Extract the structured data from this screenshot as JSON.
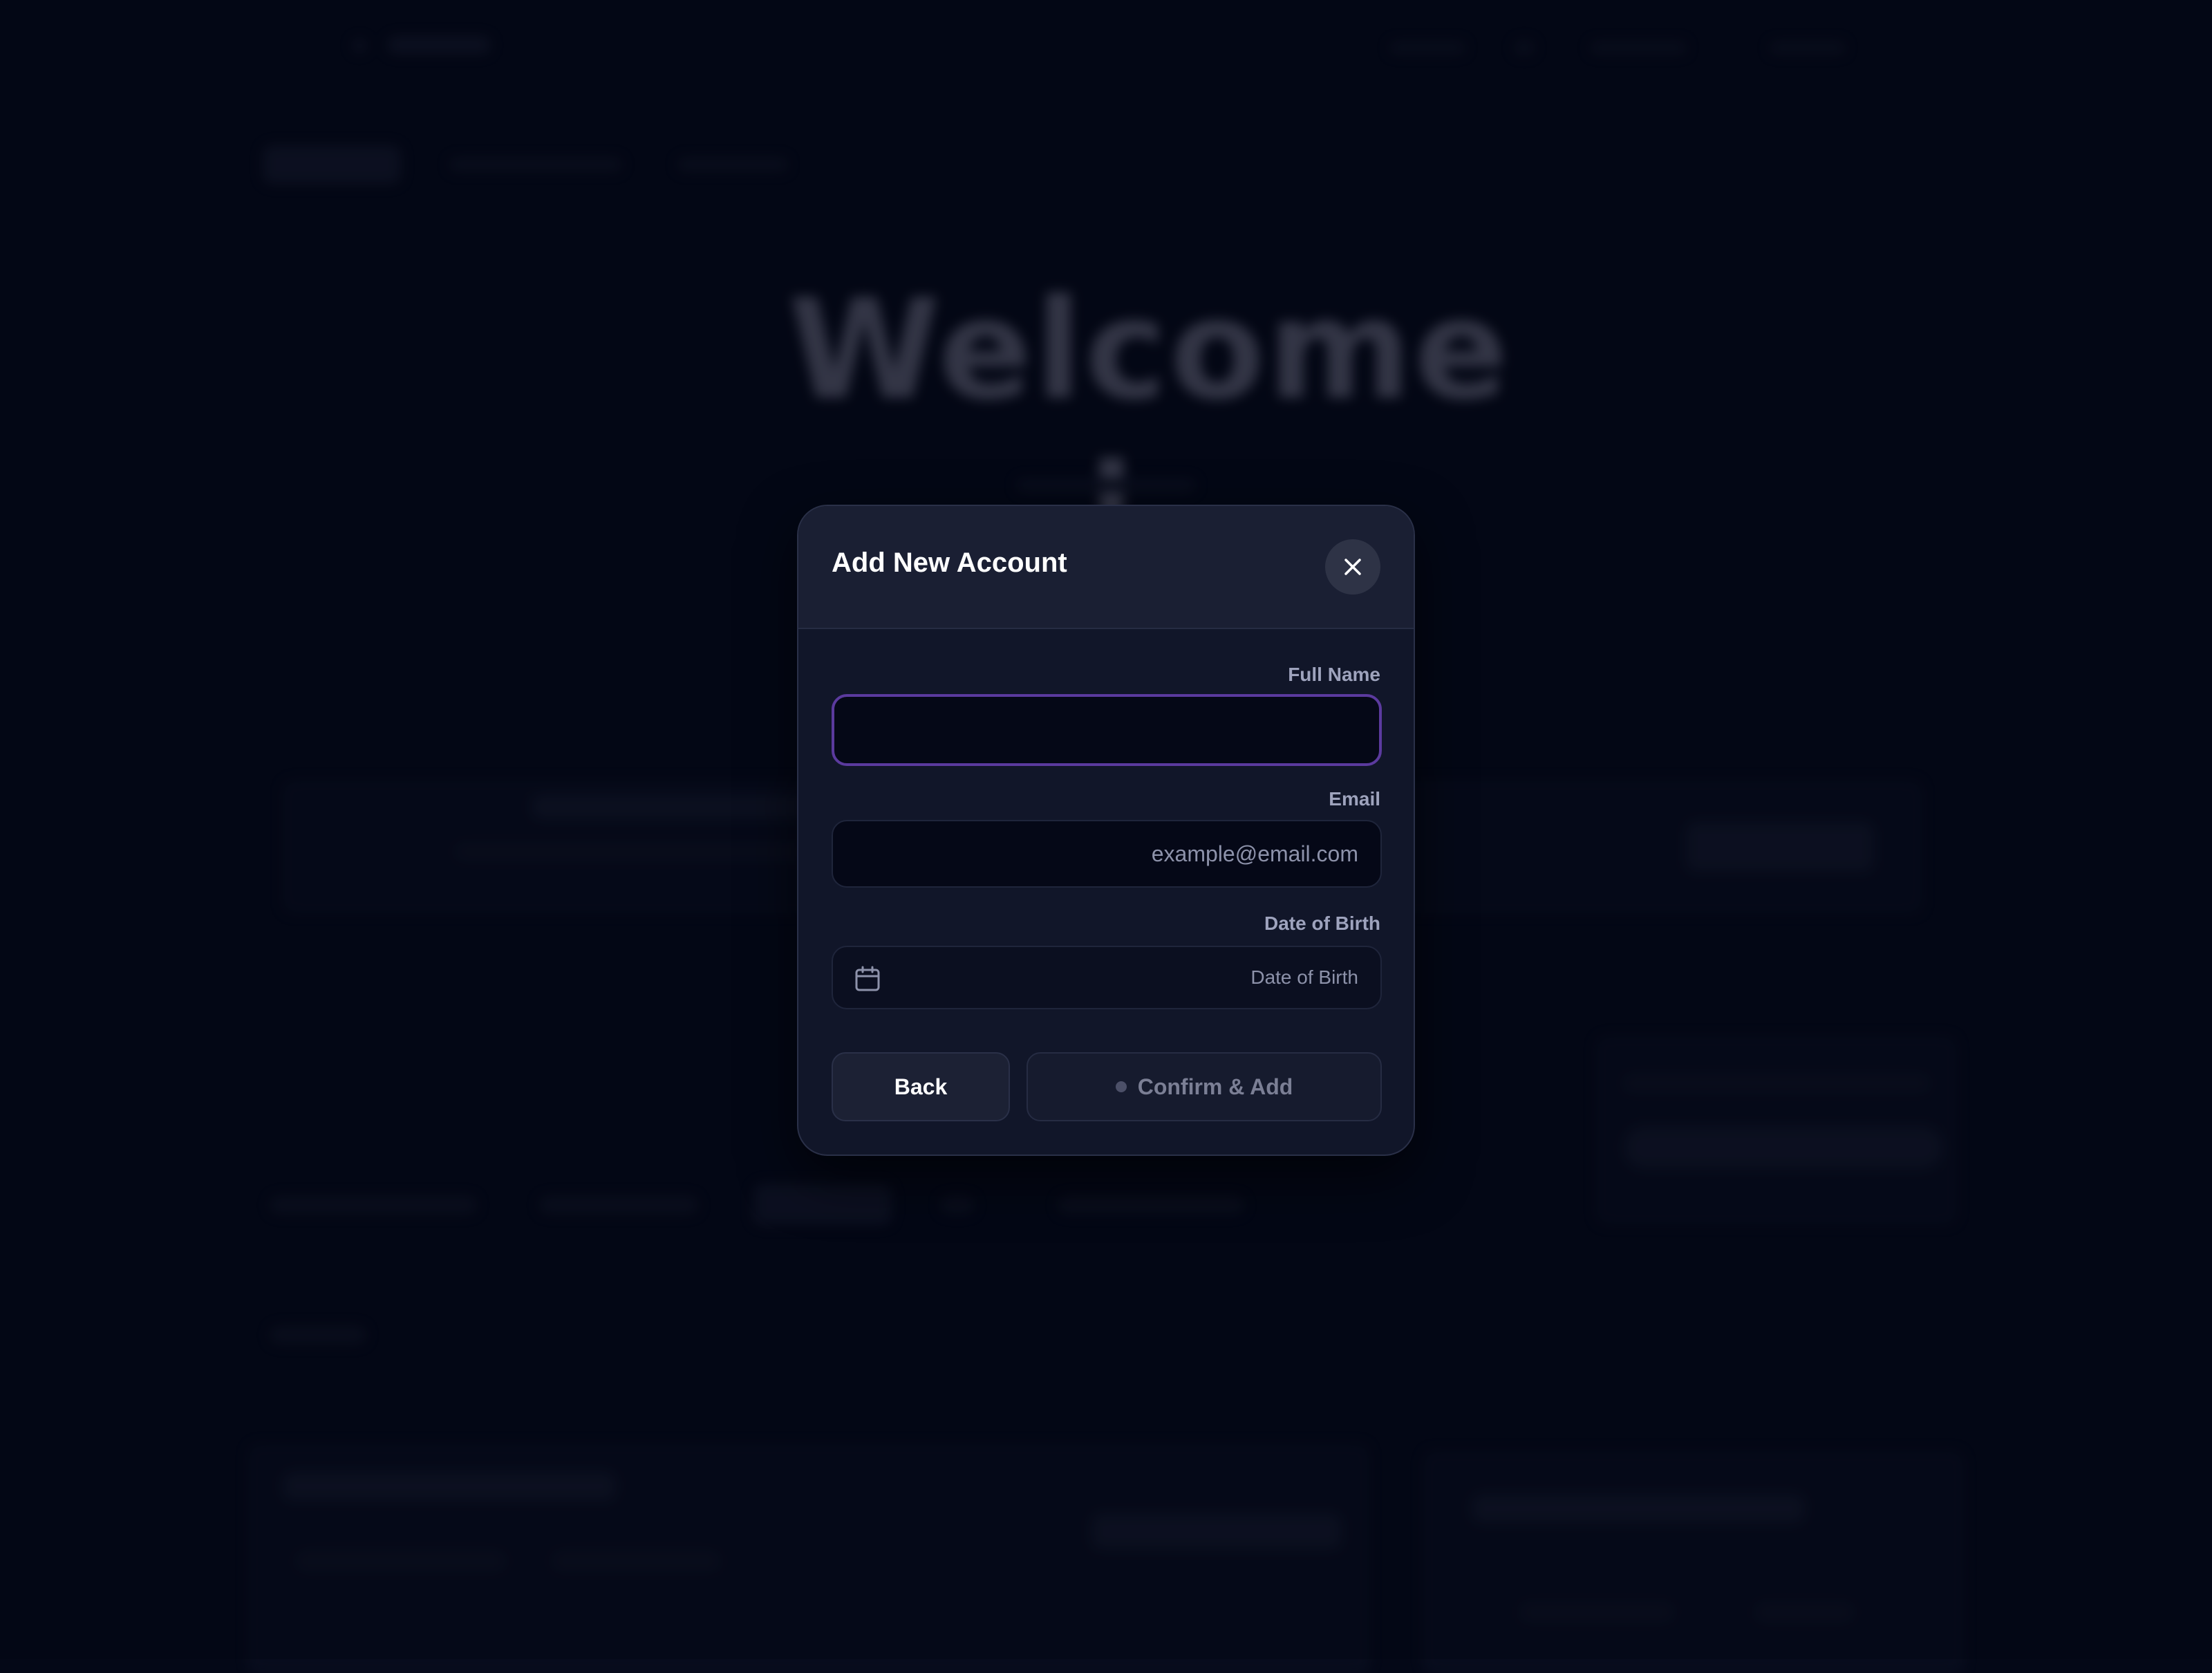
{
  "background": {
    "welcome_heading": "Welcome !"
  },
  "modal": {
    "title": "Add New Account",
    "close_icon": "close-icon",
    "fields": {
      "full_name": {
        "label": "Full Name",
        "value": "",
        "placeholder": ""
      },
      "email": {
        "label": "Email",
        "value": "",
        "placeholder": "example@email.com"
      },
      "dob": {
        "label": "Date of Birth",
        "placeholder": "Date of Birth",
        "icon": "calendar-icon"
      }
    },
    "buttons": {
      "back": "Back",
      "confirm": "Confirm & Add"
    }
  },
  "colors": {
    "accent_focus": "#5b3a9e",
    "page_bg": "#040817",
    "modal_bg": "#111629"
  }
}
